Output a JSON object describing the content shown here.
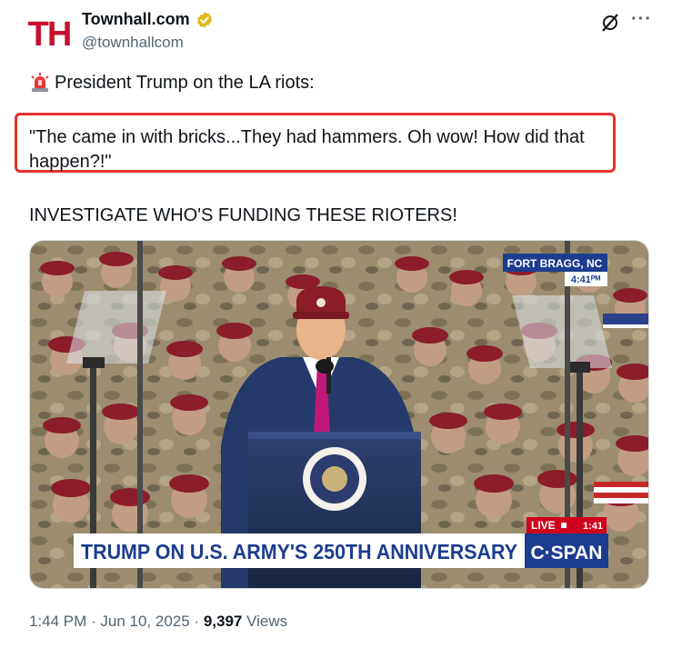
{
  "tweet": {
    "avatar_text": "TH",
    "display_name": "Townhall.com",
    "handle": "@townhallcom",
    "line1": "President Trump on the LA riots:",
    "quote": "\"The came in with bricks...They had hammers. Oh wow! How did that happen?!\"",
    "line3": "INVESTIGATE WHO'S FUNDING THESE RIOTERS!",
    "timestamp": "1:44 PM · Jun 10, 2025 · ",
    "views_count": "9,397",
    "views_label": " Views"
  },
  "video": {
    "location": "FORT BRAGG, NC",
    "clock": "4:41ᴾᴹ",
    "live_label": "LIVE",
    "live_time": "1:41",
    "chyron": "TRUMP ON U.S. ARMY'S 250TH ANNIVERSARY",
    "network": "C·SPAN"
  },
  "icons": {
    "verified": "verified-badge-icon",
    "grok": "grok-icon",
    "more": "more-icon",
    "siren": "siren-icon"
  },
  "colors": {
    "brand_red": "#c8102e",
    "verified_gold": "#e2b719",
    "highlight_red": "#e5322a",
    "chyron_blue": "#1c3d8f",
    "beret": "#8b1e2a",
    "camo": "#9b8d6e"
  }
}
